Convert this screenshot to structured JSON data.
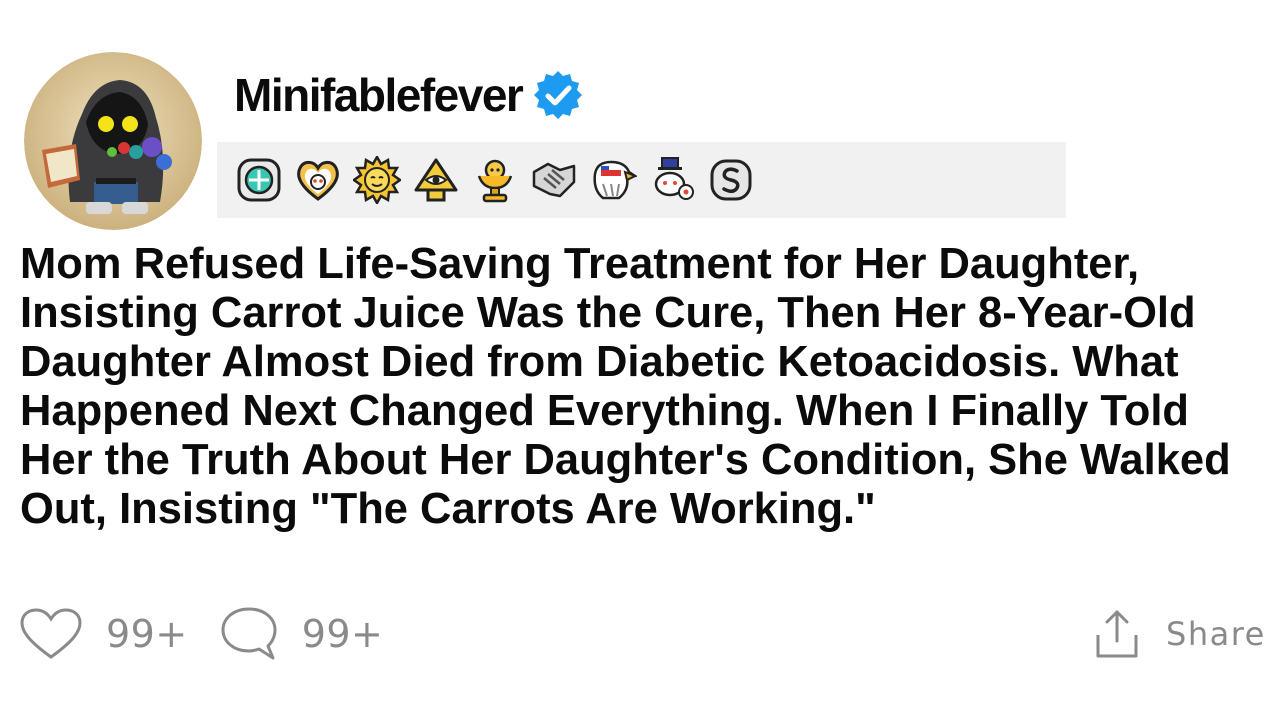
{
  "post": {
    "author": "Minifablefever",
    "verified": true,
    "title": "Mom Refused Life-Saving Treatment for Her Daughter, Insisting Carrot Juice Was the Cure, Then Her 8-Year-Old Daughter Almost Died from Diabetic Ketoacidosis. What Happened Next Changed Everything. When I Finally Told Her the Truth About Her Daughter's Condition, She Walked Out, Insisting \"The Carrots Are Working.\""
  },
  "awards": [
    {
      "icon": "rocket-badge-award-icon"
    },
    {
      "icon": "heart-snoo-award-icon"
    },
    {
      "icon": "sun-face-award-icon"
    },
    {
      "icon": "pyramid-eye-award-icon"
    },
    {
      "icon": "gold-trophy-award-icon"
    },
    {
      "icon": "handshake-award-icon"
    },
    {
      "icon": "eagle-award-icon"
    },
    {
      "icon": "top-hat-snoo-award-icon"
    },
    {
      "icon": "silver-s-award-icon"
    }
  ],
  "actions": {
    "likes": "99+",
    "comments": "99+",
    "share": "Share"
  },
  "colors": {
    "verified": "#1d9bf0",
    "action_gray": "#8a8a8a",
    "awards_bg": "#f1f1f1"
  }
}
